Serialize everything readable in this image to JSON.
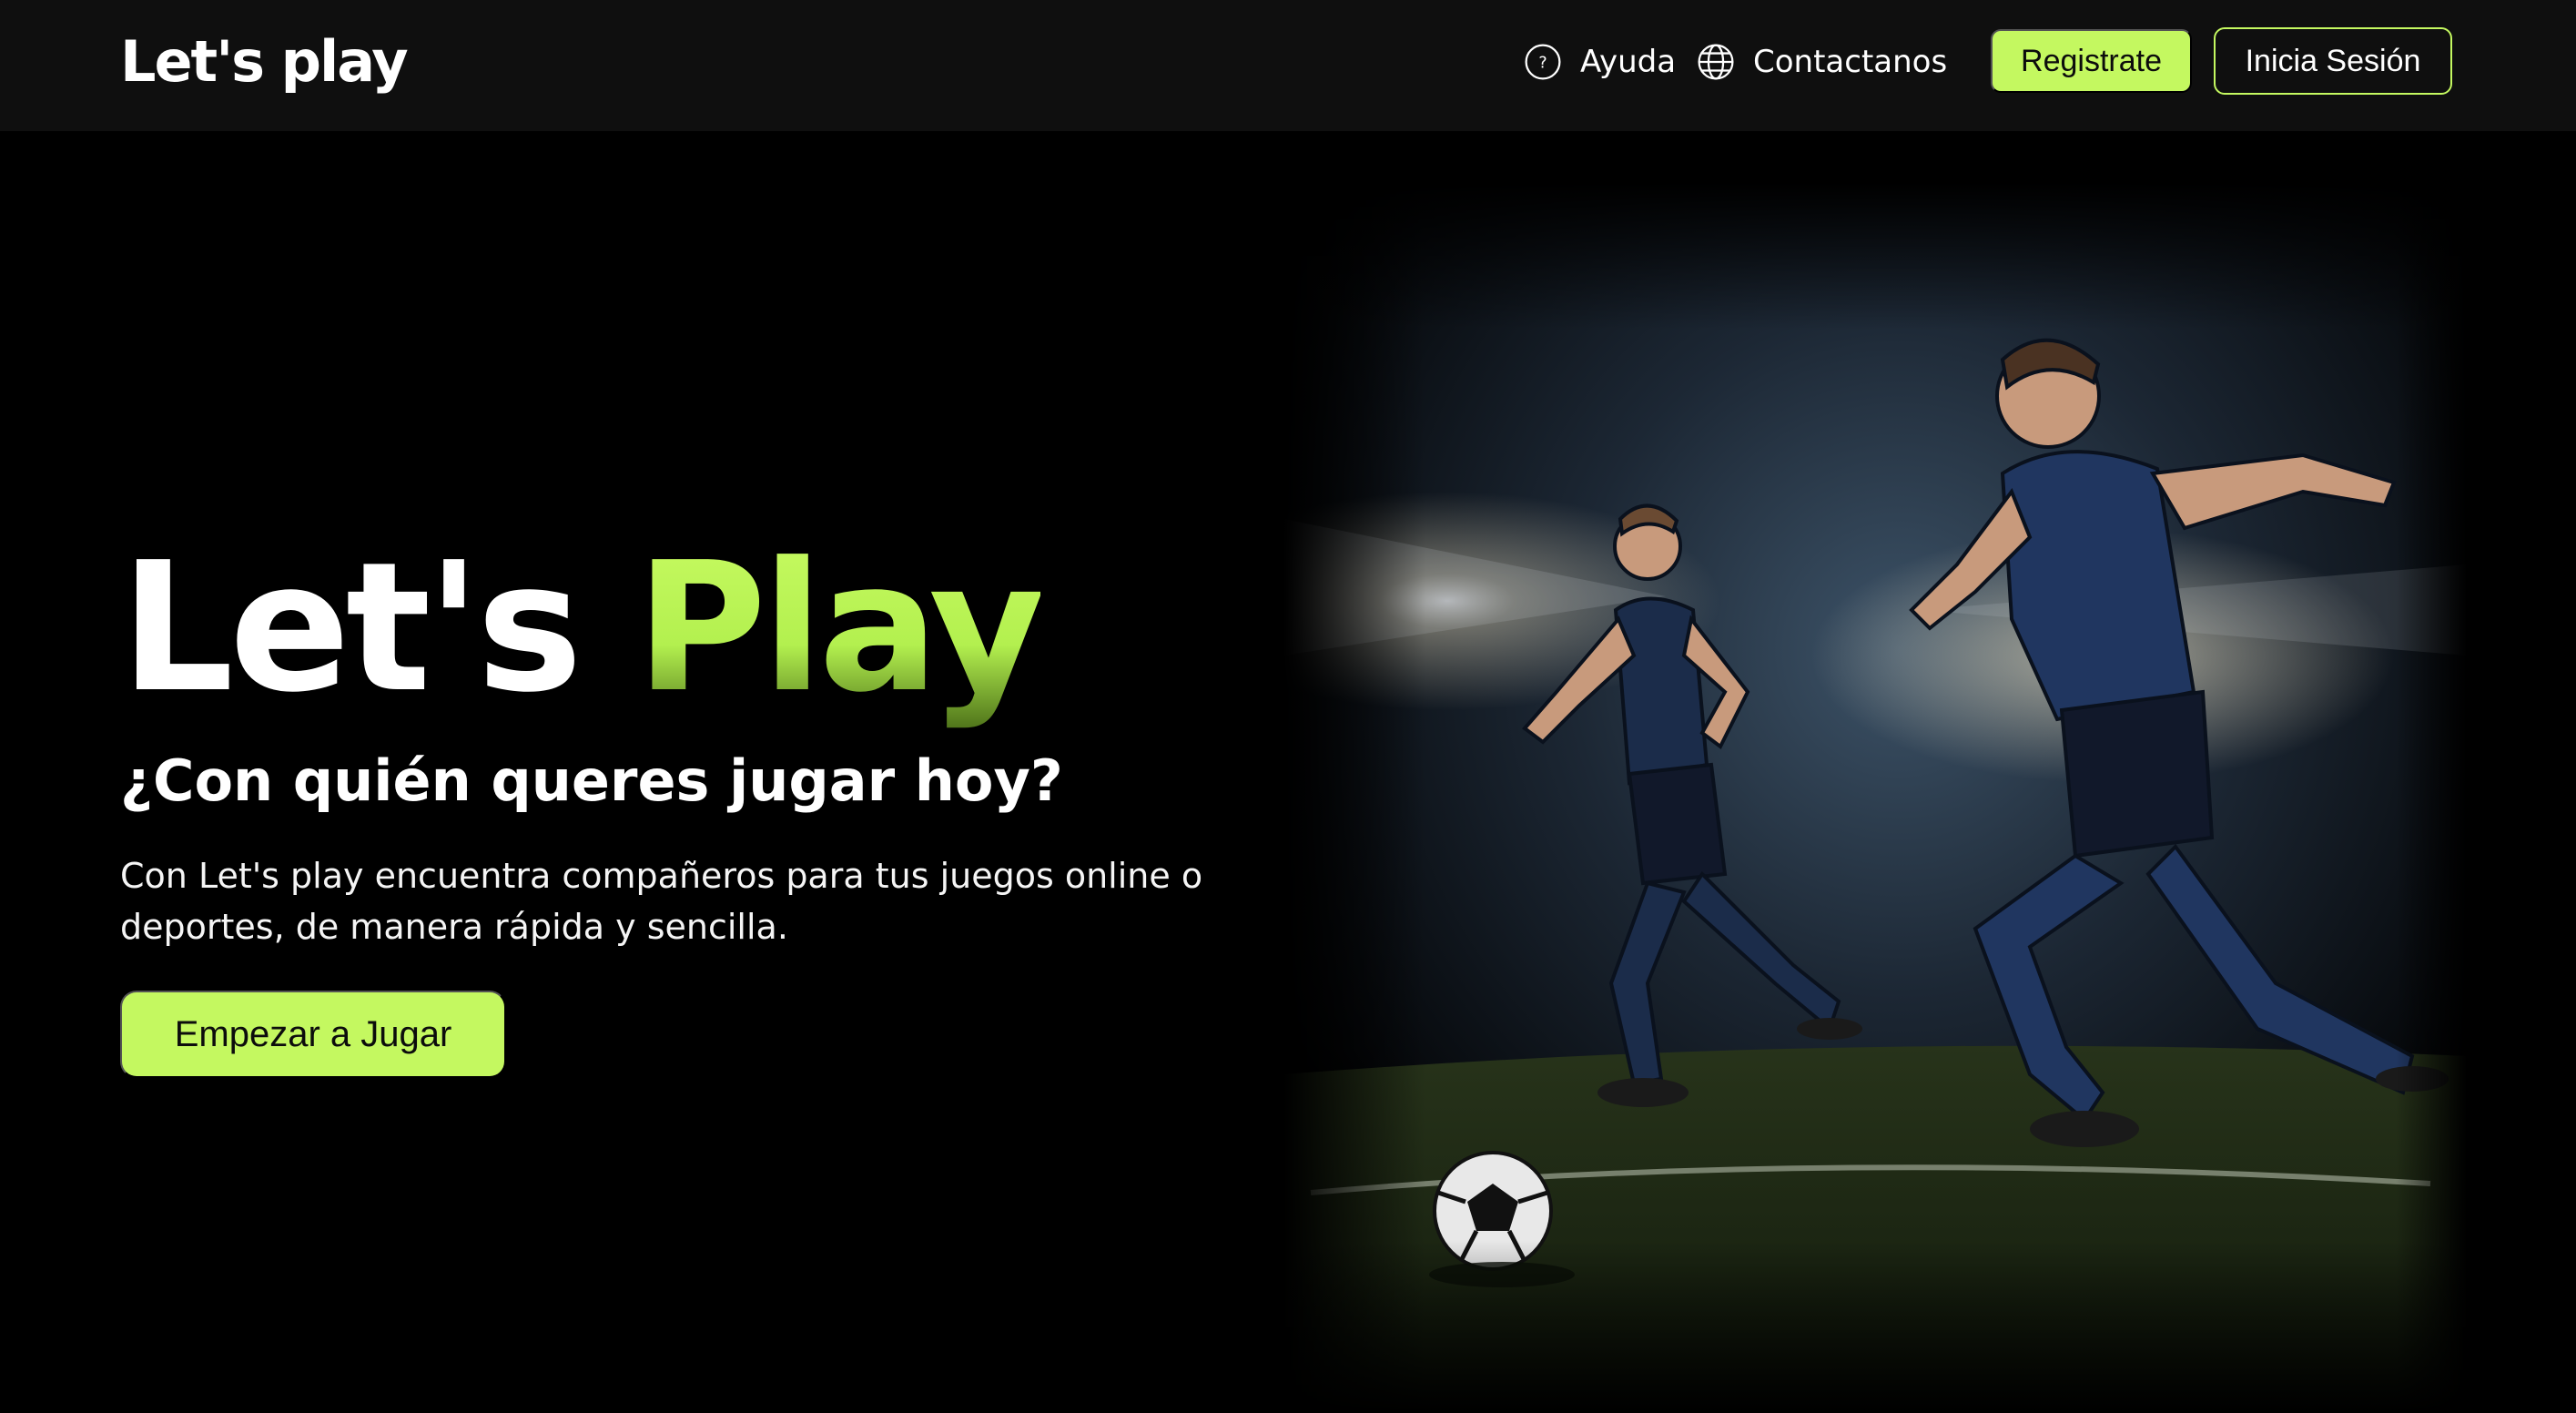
{
  "header": {
    "logo": "Let's play",
    "nav": [
      {
        "label": "Ayuda",
        "icon": "help-circle-icon"
      },
      {
        "label": "Contactanos",
        "icon": "globe-icon"
      }
    ],
    "register_label": "Registrate",
    "login_label": "Inicia Sesión"
  },
  "hero": {
    "title_part1": "Let's",
    "title_part2": "Play",
    "subtitle": "¿Con quién queres jugar hoy?",
    "description": "Con Let's play encuentra compañeros para tus juegos online o deportes, de manera rápida y sencilla.",
    "cta_label": "Empezar a Jugar",
    "image": "soccer-players-photo"
  },
  "colors": {
    "accent": "#c4f860",
    "background": "#000000",
    "header_background": "#0f0f0f",
    "text": "#ffffff"
  }
}
